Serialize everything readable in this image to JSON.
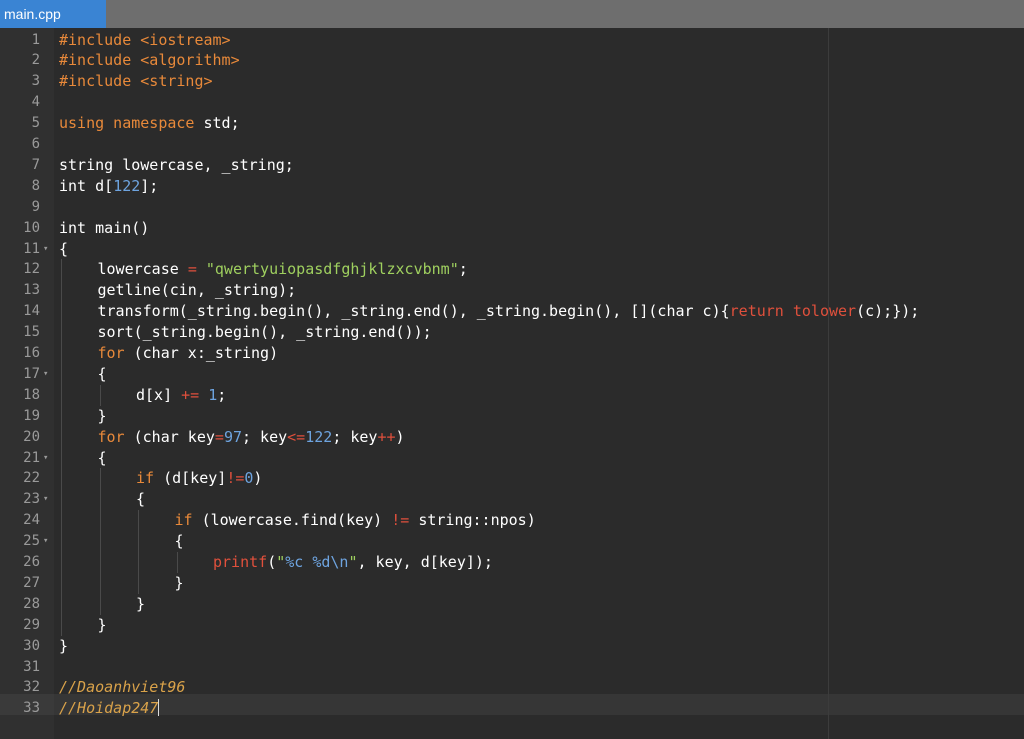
{
  "tab": {
    "title": "main.cpp"
  },
  "lines": [
    {
      "n": "1",
      "indent": 0,
      "fold": false,
      "segs": [
        {
          "t": "#include <iostream>",
          "c": "k"
        }
      ]
    },
    {
      "n": "2",
      "indent": 0,
      "fold": false,
      "segs": [
        {
          "t": "#include <algorithm>",
          "c": "k"
        }
      ]
    },
    {
      "n": "3",
      "indent": 0,
      "fold": false,
      "segs": [
        {
          "t": "#include <string>",
          "c": "k"
        }
      ]
    },
    {
      "n": "4",
      "indent": 0,
      "fold": false,
      "segs": []
    },
    {
      "n": "5",
      "indent": 0,
      "fold": false,
      "segs": [
        {
          "t": "using namespace",
          "c": "k"
        },
        {
          "t": " std;",
          "c": ""
        }
      ]
    },
    {
      "n": "6",
      "indent": 0,
      "fold": false,
      "segs": []
    },
    {
      "n": "7",
      "indent": 0,
      "fold": false,
      "segs": [
        {
          "t": "string lowercase, _string;",
          "c": ""
        }
      ]
    },
    {
      "n": "8",
      "indent": 0,
      "fold": false,
      "segs": [
        {
          "t": "int d[",
          "c": ""
        },
        {
          "t": "122",
          "c": "n"
        },
        {
          "t": "];",
          "c": ""
        }
      ]
    },
    {
      "n": "9",
      "indent": 0,
      "fold": false,
      "segs": []
    },
    {
      "n": "10",
      "indent": 0,
      "fold": false,
      "segs": [
        {
          "t": "int main()",
          "c": ""
        }
      ]
    },
    {
      "n": "11",
      "indent": 0,
      "fold": true,
      "segs": [
        {
          "t": "{",
          "c": ""
        }
      ]
    },
    {
      "n": "12",
      "indent": 1,
      "fold": false,
      "segs": [
        {
          "t": "lowercase ",
          "c": ""
        },
        {
          "t": "=",
          "c": "o"
        },
        {
          "t": " ",
          "c": ""
        },
        {
          "t": "\"qwertyuiopasdfghjklzxcvbnm\"",
          "c": "s"
        },
        {
          "t": ";",
          "c": ""
        }
      ]
    },
    {
      "n": "13",
      "indent": 1,
      "fold": false,
      "segs": [
        {
          "t": "getline(cin, _string);",
          "c": ""
        }
      ]
    },
    {
      "n": "14",
      "indent": 1,
      "fold": false,
      "segs": [
        {
          "t": "transform(_string.begin(), _string.end(), _string.begin(), [](char c){",
          "c": ""
        },
        {
          "t": "return",
          "c": "o"
        },
        {
          "t": " ",
          "c": ""
        },
        {
          "t": "tolower",
          "c": "f"
        },
        {
          "t": "(c);});",
          "c": ""
        }
      ]
    },
    {
      "n": "15",
      "indent": 1,
      "fold": false,
      "segs": [
        {
          "t": "sort(_string.begin(), _string.end());",
          "c": ""
        }
      ]
    },
    {
      "n": "16",
      "indent": 1,
      "fold": false,
      "segs": [
        {
          "t": "for",
          "c": "k"
        },
        {
          "t": " (char x:_string)",
          "c": ""
        }
      ]
    },
    {
      "n": "17",
      "indent": 1,
      "fold": true,
      "segs": [
        {
          "t": "{",
          "c": ""
        }
      ]
    },
    {
      "n": "18",
      "indent": 2,
      "fold": false,
      "segs": [
        {
          "t": "d[x] ",
          "c": ""
        },
        {
          "t": "+=",
          "c": "o"
        },
        {
          "t": " ",
          "c": ""
        },
        {
          "t": "1",
          "c": "n"
        },
        {
          "t": ";",
          "c": ""
        }
      ]
    },
    {
      "n": "19",
      "indent": 1,
      "fold": false,
      "segs": [
        {
          "t": "}",
          "c": ""
        }
      ]
    },
    {
      "n": "20",
      "indent": 1,
      "fold": false,
      "segs": [
        {
          "t": "for",
          "c": "k"
        },
        {
          "t": " (char key",
          "c": ""
        },
        {
          "t": "=",
          "c": "o"
        },
        {
          "t": "97",
          "c": "n"
        },
        {
          "t": "; key",
          "c": ""
        },
        {
          "t": "<=",
          "c": "o"
        },
        {
          "t": "122",
          "c": "n"
        },
        {
          "t": "; key",
          "c": ""
        },
        {
          "t": "++",
          "c": "o"
        },
        {
          "t": ")",
          "c": ""
        }
      ]
    },
    {
      "n": "21",
      "indent": 1,
      "fold": true,
      "segs": [
        {
          "t": "{",
          "c": ""
        }
      ]
    },
    {
      "n": "22",
      "indent": 2,
      "fold": false,
      "segs": [
        {
          "t": "if",
          "c": "k"
        },
        {
          "t": " (d[key]",
          "c": ""
        },
        {
          "t": "!=",
          "c": "o"
        },
        {
          "t": "0",
          "c": "n"
        },
        {
          "t": ")",
          "c": ""
        }
      ]
    },
    {
      "n": "23",
      "indent": 2,
      "fold": true,
      "segs": [
        {
          "t": "{",
          "c": ""
        }
      ]
    },
    {
      "n": "24",
      "indent": 3,
      "fold": false,
      "segs": [
        {
          "t": "if",
          "c": "k"
        },
        {
          "t": " (lowercase.find(key) ",
          "c": ""
        },
        {
          "t": "!=",
          "c": "o"
        },
        {
          "t": " string::npos)",
          "c": ""
        }
      ]
    },
    {
      "n": "25",
      "indent": 3,
      "fold": true,
      "segs": [
        {
          "t": "{",
          "c": ""
        }
      ]
    },
    {
      "n": "26",
      "indent": 4,
      "fold": false,
      "segs": [
        {
          "t": "printf",
          "c": "f"
        },
        {
          "t": "(",
          "c": ""
        },
        {
          "t": "\"",
          "c": "s"
        },
        {
          "t": "%c %d\\n",
          "c": "n"
        },
        {
          "t": "\"",
          "c": "s"
        },
        {
          "t": ", key, d[key]);",
          "c": ""
        }
      ]
    },
    {
      "n": "27",
      "indent": 3,
      "fold": false,
      "segs": [
        {
          "t": "}",
          "c": ""
        }
      ]
    },
    {
      "n": "28",
      "indent": 2,
      "fold": false,
      "segs": [
        {
          "t": "}",
          "c": ""
        }
      ]
    },
    {
      "n": "29",
      "indent": 1,
      "fold": false,
      "segs": [
        {
          "t": "}",
          "c": ""
        }
      ]
    },
    {
      "n": "30",
      "indent": 0,
      "fold": false,
      "segs": [
        {
          "t": "}",
          "c": ""
        }
      ]
    },
    {
      "n": "31",
      "indent": 0,
      "fold": false,
      "segs": []
    },
    {
      "n": "32",
      "indent": 0,
      "fold": false,
      "segs": [
        {
          "t": "//Daoanhviet96",
          "c": "c"
        }
      ]
    },
    {
      "n": "33",
      "indent": 0,
      "fold": false,
      "cursor": true,
      "segs": [
        {
          "t": "//Hoidap247",
          "c": "c"
        }
      ]
    }
  ]
}
